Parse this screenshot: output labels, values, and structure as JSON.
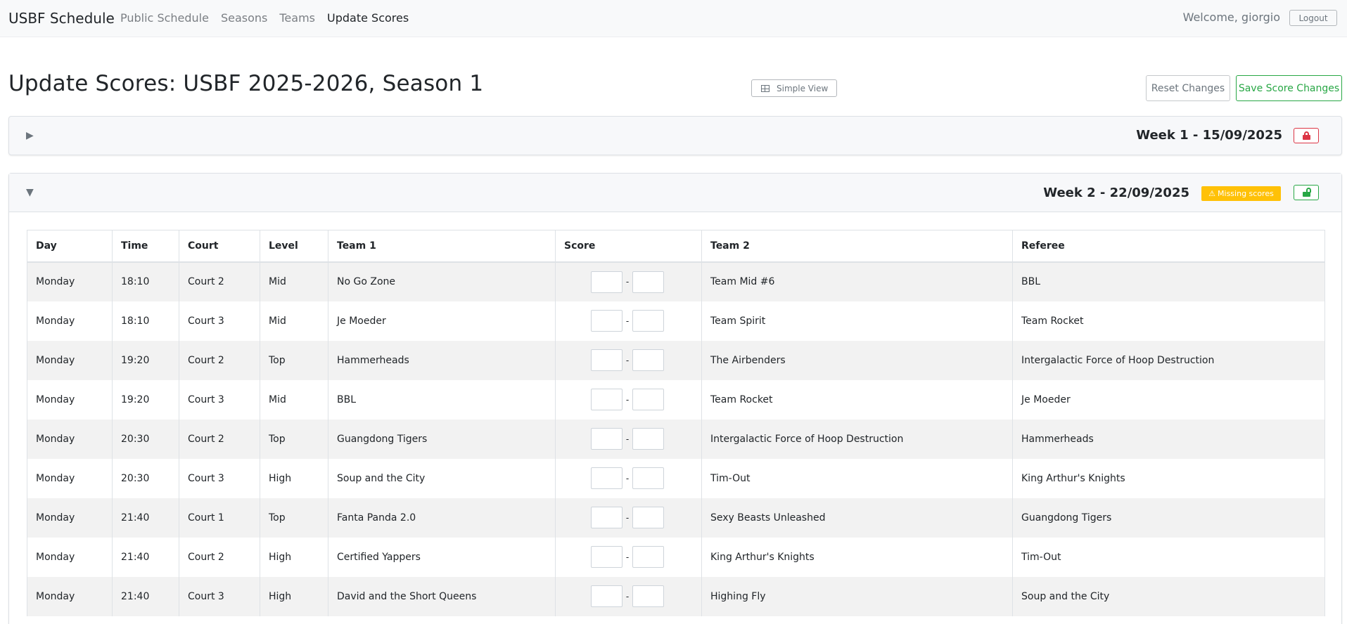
{
  "navbar": {
    "brand": "USBF Schedule",
    "links": [
      "Public Schedule",
      "Seasons",
      "Teams",
      "Update Scores"
    ],
    "welcome": "Welcome, giorgio",
    "logout": "Logout"
  },
  "header": {
    "title": "Update Scores: USBF 2025-2026, Season 1",
    "simple_view": "Simple View",
    "reset": "Reset Changes",
    "save": "Save Score Changes"
  },
  "weeks": [
    {
      "title": "Week 1 - 15/09/2025",
      "toggle": "▶",
      "locked": true
    },
    {
      "title": "Week 2 - 22/09/2025",
      "toggle": "▼",
      "locked": false,
      "badge": "Missing scores",
      "badge_icon": "⚠"
    }
  ],
  "table": {
    "headers": [
      "Day",
      "Time",
      "Court",
      "Level",
      "Team 1",
      "Score",
      "Team 2",
      "Referee"
    ],
    "score_separator": "-",
    "rows": [
      {
        "day": "Monday",
        "time": "18:10",
        "court": "Court 2",
        "level": "Mid",
        "team1": "No Go Zone",
        "team2": "Team Mid #6",
        "referee": "BBL"
      },
      {
        "day": "Monday",
        "time": "18:10",
        "court": "Court 3",
        "level": "Mid",
        "team1": "Je Moeder",
        "team2": "Team Spirit",
        "referee": "Team Rocket"
      },
      {
        "day": "Monday",
        "time": "19:20",
        "court": "Court 2",
        "level": "Top",
        "team1": "Hammerheads",
        "team2": "The Airbenders",
        "referee": "Intergalactic Force of Hoop Destruction"
      },
      {
        "day": "Monday",
        "time": "19:20",
        "court": "Court 3",
        "level": "Mid",
        "team1": "BBL",
        "team2": "Team Rocket",
        "referee": "Je Moeder"
      },
      {
        "day": "Monday",
        "time": "20:30",
        "court": "Court 2",
        "level": "Top",
        "team1": "Guangdong Tigers",
        "team2": "Intergalactic Force of Hoop Destruction",
        "referee": "Hammerheads"
      },
      {
        "day": "Monday",
        "time": "20:30",
        "court": "Court 3",
        "level": "High",
        "team1": "Soup and the City",
        "team2": "Tim-Out",
        "referee": "King Arthur's Knights"
      },
      {
        "day": "Monday",
        "time": "21:40",
        "court": "Court 1",
        "level": "Top",
        "team1": "Fanta Panda 2.0",
        "team2": "Sexy Beasts Unleashed",
        "referee": "Guangdong Tigers"
      },
      {
        "day": "Monday",
        "time": "21:40",
        "court": "Court 2",
        "level": "High",
        "team1": "Certified Yappers",
        "team2": "King Arthur's Knights",
        "referee": "Tim-Out"
      },
      {
        "day": "Monday",
        "time": "21:40",
        "court": "Court 3",
        "level": "High",
        "team1": "David and the Short Queens",
        "team2": "Highing Fly",
        "referee": "Soup and the City"
      }
    ]
  }
}
